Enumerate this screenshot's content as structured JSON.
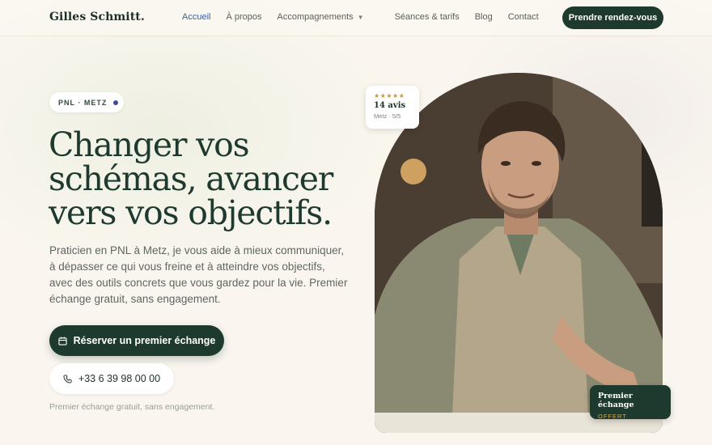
{
  "brand": {
    "name": "Gilles Schmitt."
  },
  "nav": {
    "items": [
      {
        "label": "Accueil"
      },
      {
        "label": "À propos"
      },
      {
        "label": "Accompagnements"
      },
      {
        "label": "Séances & tarifs"
      },
      {
        "label": "Blog"
      },
      {
        "label": "Contact"
      }
    ],
    "active_index": 0,
    "cta_label": "Prendre rendez-vous"
  },
  "hero": {
    "tag": "PNL · METZ",
    "title_lines": [
      "Changer vos",
      "schémas, avancer",
      "vers vos objectifs."
    ],
    "lead": "Praticien en PNL à Metz, je vous aide à mieux communiquer, à dépasser ce qui vous freine et à atteindre vos objectifs, avec des outils concrets que vous gardez pour la vie. Premier échange gratuit, sans engagement.",
    "primary_cta": "Réserver un premier échange",
    "phone": "+33 6 39 98 00 00",
    "note": "Premier échange gratuit, sans engagement."
  },
  "review_card": {
    "stars": "★★★★★",
    "count": "14 avis",
    "meta": "Metz · 5/5",
    "rating": 5
  },
  "offer_card": {
    "title": "Premier échange",
    "subtitle": "OFFERT"
  },
  "colors": {
    "primary": "#1e3a2f",
    "accent_link": "#3a5ea0",
    "background": "#faf6ef",
    "gold": "#c9a95c"
  }
}
